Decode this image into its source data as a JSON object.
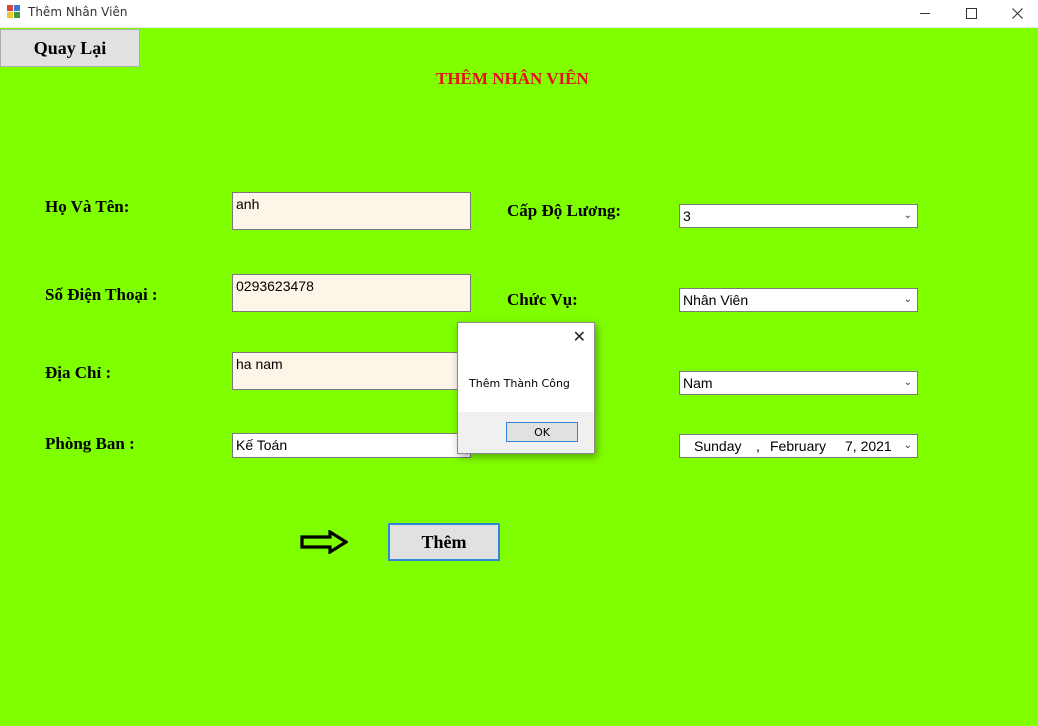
{
  "window": {
    "title": "Thêm Nhân Viên",
    "minimize_icon": "minimize-icon",
    "maximize_icon": "maximize-icon",
    "close_icon": "close-icon"
  },
  "colors": {
    "form_background": "#80ff00",
    "title_color": "#e8101a",
    "textbox_background": "#fdf5e8",
    "accent_border": "#2f86d9"
  },
  "toolbar": {
    "back_label": "Quay Lại"
  },
  "form": {
    "title": "THÊM NHÂN VIÊN",
    "labels": {
      "name": "Họ Và Tên:",
      "phone": "Số Điện Thoại :",
      "address": "Địa Chỉ :",
      "department": "Phòng Ban :",
      "salary_level": "Cấp Độ Lương:",
      "position": "Chức Vụ:"
    },
    "values": {
      "name": "anh",
      "phone": "0293623478",
      "address": "ha nam",
      "department": "Kế Toán"
    },
    "combos": {
      "salary_level": "3",
      "position": "Nhân Viên",
      "gender": "Nam",
      "date": {
        "weekday": "Sunday",
        "sep": ",",
        "month": "February",
        "day_year": "7, 2021"
      }
    },
    "add_label": "Thêm",
    "arrow_icon": "arrow-right-icon"
  },
  "dialog": {
    "message": "Thêm Thành Công",
    "ok_label": "OK",
    "close_glyph": "✕"
  }
}
